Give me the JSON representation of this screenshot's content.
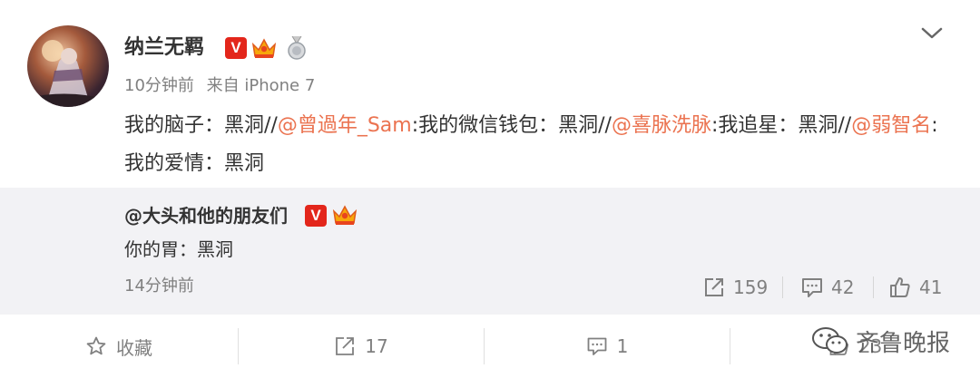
{
  "post": {
    "username": "纳兰无羁",
    "verified_badge": "V",
    "crown_icon": "crown-icon",
    "medal_icon": "medal-icon",
    "time": "10分钟前",
    "source": "来自 iPhone 7",
    "content": [
      {
        "text": "我的脑子：黑洞//",
        "mention": false
      },
      {
        "text": "@曾過年_Sam",
        "mention": true
      },
      {
        "text": ":我的微信钱包：黑洞//",
        "mention": false
      },
      {
        "text": "@喜脉洗脉",
        "mention": true
      },
      {
        "text": ":我追星：黑洞//",
        "mention": false
      },
      {
        "text": "@弱智名",
        "mention": true
      },
      {
        "text": ":我的爱情：黑洞",
        "mention": false
      }
    ]
  },
  "repost": {
    "author": "@大头和他的朋友们",
    "verified_badge": "V",
    "text": "你的胃：黑洞",
    "time": "14分钟前",
    "repost_count": "159",
    "comment_count": "42",
    "like_count": "41"
  },
  "bottom_bar": {
    "favorite_label": "收藏",
    "repost_count": "17",
    "comment_count": "1",
    "like_count": "23",
    "watermark_text": "齐鲁晚报"
  },
  "colors": {
    "mention": "#eb7350",
    "verified_red": "#e3261b",
    "muted": "#808080",
    "repost_bg": "#f2f2f5"
  }
}
